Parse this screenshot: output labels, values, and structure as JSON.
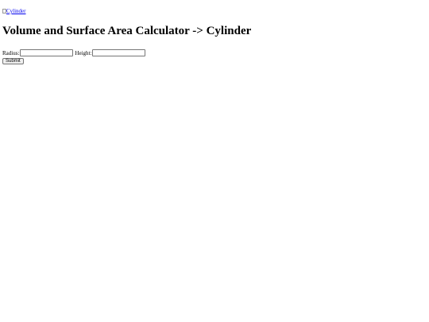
{
  "header": {
    "image_alt": "Cylinder",
    "broken_image_icon": "broken-image-icon"
  },
  "page_title": "Volume and Surface Area Calculator -> Cylinder",
  "form": {
    "radius_label": "Radius:",
    "radius_value": "",
    "height_label": "Height:",
    "height_value": "",
    "submit_label": "Submit"
  },
  "colors": {
    "link": "#0000ee",
    "text": "#000000",
    "background": "#ffffff"
  }
}
